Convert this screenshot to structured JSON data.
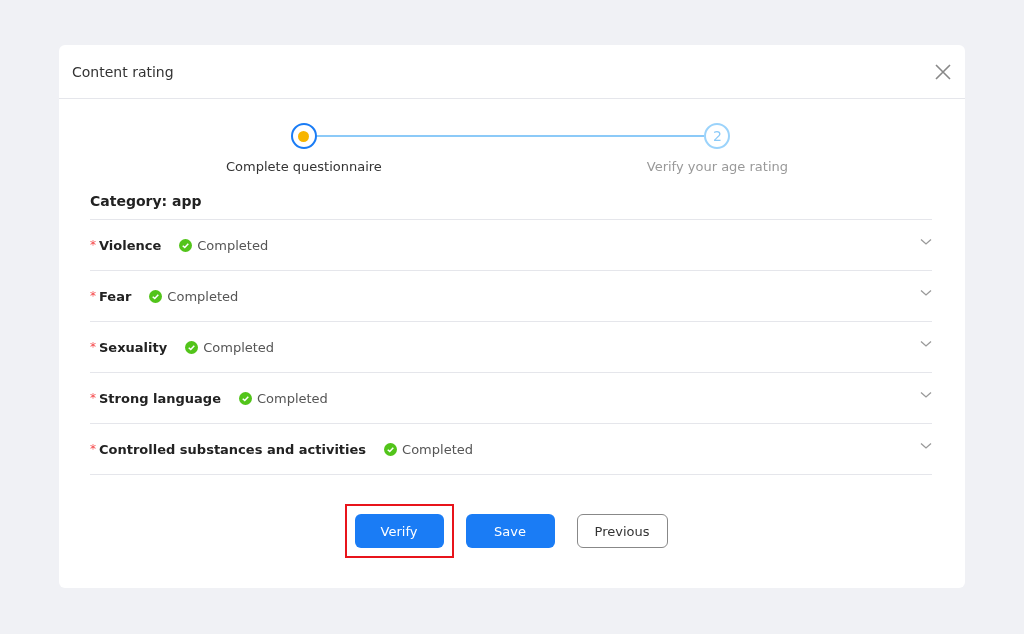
{
  "dialog": {
    "title": "Content rating"
  },
  "steps": [
    {
      "kind": "current",
      "label": "Complete questionnaire"
    },
    {
      "kind": "pending",
      "number": "2",
      "label": "Verify your age rating"
    }
  ],
  "category": "Category: app",
  "sections": [
    {
      "required_mark": "*",
      "title": "Violence",
      "status": "Completed",
      "expanded": false
    },
    {
      "required_mark": "*",
      "title": "Fear",
      "status": "Completed",
      "expanded": false
    },
    {
      "required_mark": "*",
      "title": "Sexuality",
      "status": "Completed",
      "expanded": false
    },
    {
      "required_mark": "*",
      "title": "Strong language",
      "status": "Completed",
      "expanded": false
    },
    {
      "required_mark": "*",
      "title": "Controlled substances and activities",
      "status": "Completed",
      "expanded": false
    }
  ],
  "buttons": [
    {
      "label": "Verify",
      "kind": "primary",
      "highlighted": true
    },
    {
      "label": "Save",
      "kind": "primary",
      "highlighted": false
    },
    {
      "label": "Previous",
      "kind": "default",
      "highlighted": false
    }
  ]
}
